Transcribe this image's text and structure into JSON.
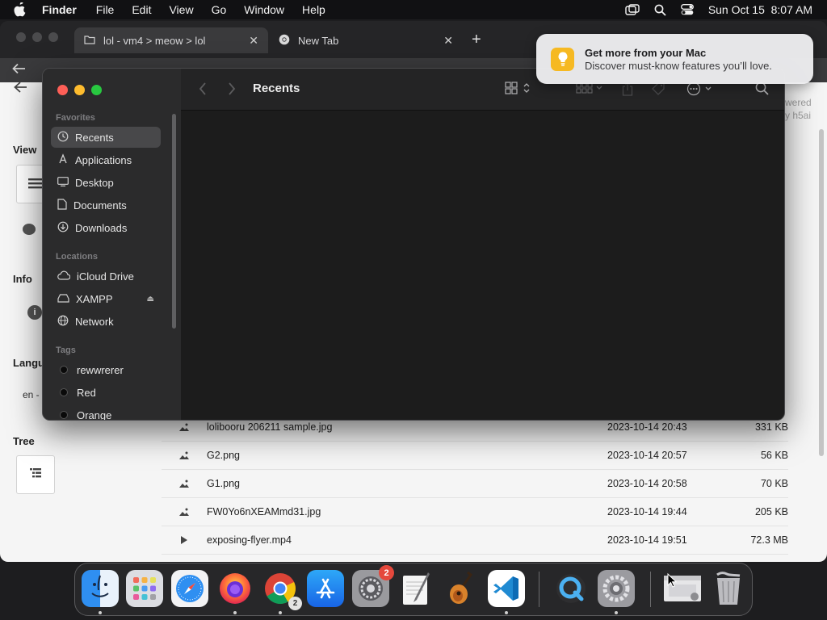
{
  "menubar": {
    "apple_icon": "apple-logo-icon",
    "app_name": "Finder",
    "menus": [
      "File",
      "Edit",
      "View",
      "Go",
      "Window",
      "Help"
    ],
    "datetime": "Sun Oct 15  8:07 AM",
    "status_icons": [
      "screen-mirroring-icon",
      "spotlight-search-icon",
      "control-center-icon"
    ]
  },
  "browser": {
    "tabs": [
      {
        "title": "lol - vm4 > meow > lol",
        "icon": "folder-icon"
      },
      {
        "title": "New Tab",
        "icon": "chrome-icon"
      }
    ],
    "new_tab": "+",
    "page": {
      "view_label": "View",
      "info_label": "Info",
      "language_label": "Langu",
      "language_value": "en -",
      "tree_label": "Tree",
      "powered_text_1": "wered",
      "powered_text_2": "y h5ai",
      "info_glyph": "i"
    },
    "files": [
      {
        "name": "lolibooru 206211 sample.jpg",
        "date": "2023-10-14 20:43",
        "size": "331 KB",
        "icon": "image-file-icon"
      },
      {
        "name": "G2.png",
        "date": "2023-10-14 20:57",
        "size": "56 KB",
        "icon": "image-file-icon"
      },
      {
        "name": "G1.png",
        "date": "2023-10-14 20:58",
        "size": "70 KB",
        "icon": "image-file-icon"
      },
      {
        "name": "FW0Yo6nXEAMmd31.jpg",
        "date": "2023-10-14 19:44",
        "size": "205 KB",
        "icon": "image-file-icon"
      },
      {
        "name": "exposing-flyer.mp4",
        "date": "2023-10-14 19:51",
        "size": "72.3 MB",
        "icon": "video-play-icon"
      }
    ]
  },
  "finder": {
    "title": "Recents",
    "sidebar": {
      "favorites_label": "Favorites",
      "favorites": [
        {
          "label": "Recents",
          "icon": "clock-icon",
          "selected": true
        },
        {
          "label": "Applications",
          "icon": "applications-icon"
        },
        {
          "label": "Desktop",
          "icon": "desktop-icon"
        },
        {
          "label": "Documents",
          "icon": "document-icon"
        },
        {
          "label": "Downloads",
          "icon": "download-icon"
        }
      ],
      "locations_label": "Locations",
      "locations": [
        {
          "label": "iCloud Drive",
          "icon": "cloud-icon"
        },
        {
          "label": "XAMPP",
          "icon": "disk-icon",
          "eject": "⏏"
        },
        {
          "label": "Network",
          "icon": "globe-icon"
        }
      ],
      "tags_label": "Tags",
      "tags": [
        {
          "label": "rewwrerer"
        },
        {
          "label": "Red"
        },
        {
          "label": "Orange"
        }
      ]
    }
  },
  "notification": {
    "title": "Get more from your Mac",
    "body": "Discover must-know features you’ll love.",
    "icon": "lightbulb-icon",
    "icon_color": "#f6b922"
  },
  "dock": {
    "apps": [
      {
        "name": "Finder",
        "icon": "finder-icon"
      },
      {
        "name": "Launchpad",
        "icon": "launchpad-icon"
      },
      {
        "name": "Safari",
        "icon": "safari-icon"
      },
      {
        "name": "Firefox",
        "icon": "firefox-icon"
      },
      {
        "name": "Google Chrome",
        "icon": "chrome-icon",
        "badge": "2"
      },
      {
        "name": "App Store",
        "icon": "app-store-icon"
      },
      {
        "name": "System Preferences",
        "icon": "system-settings-icon",
        "badge": "2"
      },
      {
        "name": "TextEdit",
        "icon": "textedit-icon"
      },
      {
        "name": "GarageBand",
        "icon": "garageband-icon"
      },
      {
        "name": "Visual Studio Code",
        "icon": "vscode-icon"
      },
      {
        "name": "QuickTime Player",
        "icon": "quicktime-icon"
      },
      {
        "name": "Settings",
        "icon": "settings-gear-icon"
      },
      {
        "name": "Screenshot",
        "icon": "screenshot-icon"
      },
      {
        "name": "Trash",
        "icon": "trash-icon"
      }
    ]
  }
}
